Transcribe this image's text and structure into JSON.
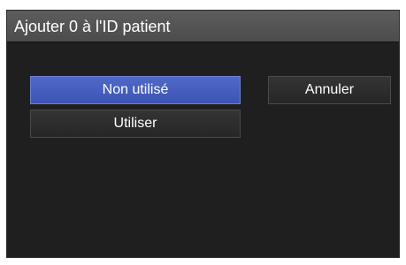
{
  "dialog": {
    "title": "Ajouter 0 à l'ID patient"
  },
  "buttons": {
    "not_used": "Non utilisé",
    "use": "Utiliser",
    "cancel": "Annuler"
  },
  "state": {
    "selected": "not_used"
  },
  "colors": {
    "selected_accent": "#4a5fbf",
    "dialog_background": "#1f1f1f",
    "title_bar": "#545454"
  }
}
